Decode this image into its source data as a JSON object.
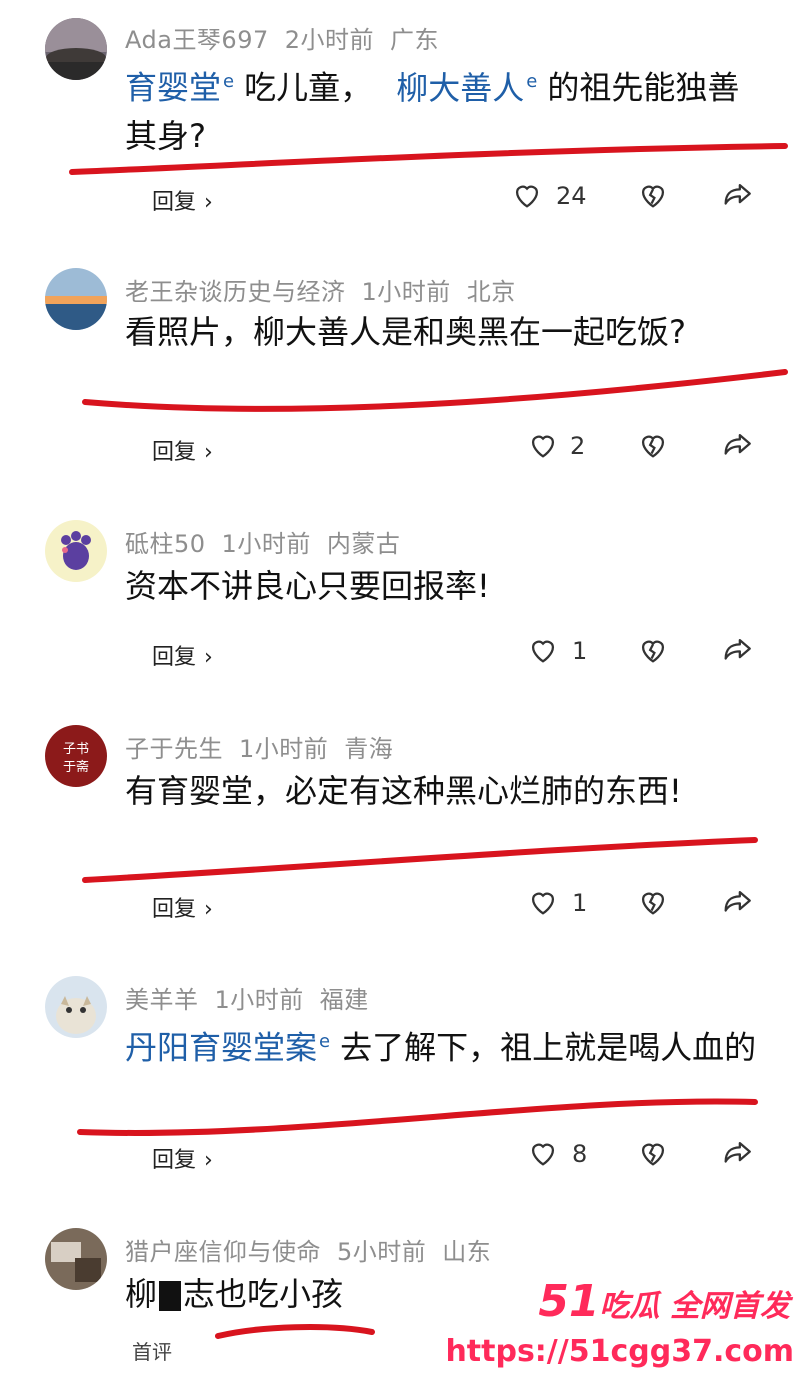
{
  "comments": [
    {
      "user": "Ada王琴697",
      "time": "2小时前",
      "location": "广东",
      "link1": "育婴堂",
      "text1": "吃儿童，",
      "link2": "柳大善人",
      "text2": "的祖先能独善其身?",
      "reply": "回复",
      "likes": "24"
    },
    {
      "user": "老王杂谈历史与经济",
      "time": "1小时前",
      "location": "北京",
      "text": "看照片，柳大善人是和奥黑在一起吃饭?",
      "reply": "回复",
      "likes": "2"
    },
    {
      "user": "砥柱50",
      "time": "1小时前",
      "location": "内蒙古",
      "text": "资本不讲良心只要回报率!",
      "reply": "回复",
      "likes": "1"
    },
    {
      "user": "子于先生",
      "time": "1小时前",
      "location": "青海",
      "text": "有育婴堂，必定有这种黑心烂肺的东西!",
      "reply": "回复",
      "likes": "1",
      "avatar_text": "子书于斋"
    },
    {
      "user": "美羊羊",
      "time": "1小时前",
      "location": "福建",
      "link1": "丹阳育婴堂案",
      "text1": "去了解下，祖上就是喝人血的",
      "reply": "回复",
      "likes": "8"
    },
    {
      "user": "猎户座信仰与使命",
      "time": "5小时前",
      "location": "山东",
      "text_a": "柳",
      "text_b": "志也吃小孩",
      "label": "首评"
    }
  ],
  "icons": {
    "like": "heart-outline-icon",
    "dislike": "broken-heart-icon",
    "share": "share-arrow-icon",
    "chevron": "chevron-right-icon"
  },
  "watermark": {
    "brand_num": "51",
    "brand_text": "吃瓜 全网首发",
    "url": "https://51cgg37.com"
  },
  "colors": {
    "link": "#1f5fa8",
    "meta": "#8e8e8e",
    "underline": "#d8141e",
    "watermark": "#ff2a5a"
  }
}
